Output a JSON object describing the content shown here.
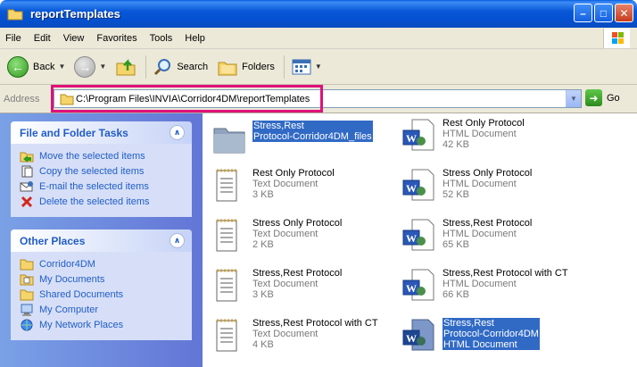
{
  "window": {
    "title": "reportTemplates"
  },
  "menu": [
    "File",
    "Edit",
    "View",
    "Favorites",
    "Tools",
    "Help"
  ],
  "toolbar": {
    "back": "Back",
    "search": "Search",
    "folders": "Folders"
  },
  "address": {
    "label": "Address",
    "path": "C:\\Program Files\\INVIA\\Corridor4DM\\reportTemplates",
    "go": "Go"
  },
  "tasks": {
    "title": "File and Folder Tasks",
    "items": [
      "Move the selected items",
      "Copy the selected items",
      "E-mail the selected items",
      "Delete the selected items"
    ]
  },
  "places": {
    "title": "Other Places",
    "items": [
      "Corridor4DM",
      "My Documents",
      "Shared Documents",
      "My Computer",
      "My Network Places"
    ]
  },
  "files": [
    {
      "name": "Stress,Rest",
      "name2": "Protocol-Corridor4DM_files",
      "type": "",
      "size": "",
      "kind": "folder",
      "selected": true
    },
    {
      "name": "Rest Only Protocol",
      "type": "HTML Document",
      "size": "42 KB",
      "kind": "html",
      "selected": false
    },
    {
      "name": "Rest Only Protocol",
      "type": "Text Document",
      "size": "3 KB",
      "kind": "txt",
      "selected": false
    },
    {
      "name": "Stress Only Protocol",
      "type": "HTML Document",
      "size": "52 KB",
      "kind": "html",
      "selected": false
    },
    {
      "name": "Stress Only Protocol",
      "type": "Text Document",
      "size": "2 KB",
      "kind": "txt",
      "selected": false
    },
    {
      "name": "Stress,Rest Protocol",
      "type": "HTML Document",
      "size": "65 KB",
      "kind": "html",
      "selected": false
    },
    {
      "name": "Stress,Rest Protocol",
      "type": "Text Document",
      "size": "3 KB",
      "kind": "txt",
      "selected": false
    },
    {
      "name": "Stress,Rest Protocol with CT",
      "type": "HTML Document",
      "size": "66 KB",
      "kind": "html",
      "selected": false
    },
    {
      "name": "Stress,Rest Protocol with CT",
      "type": "Text Document",
      "size": "4 KB",
      "kind": "txt",
      "selected": false
    },
    {
      "name": "Stress,Rest",
      "name2": "Protocol-Corridor4DM",
      "type": "HTML Document",
      "size": "",
      "kind": "html",
      "selected": true
    }
  ]
}
